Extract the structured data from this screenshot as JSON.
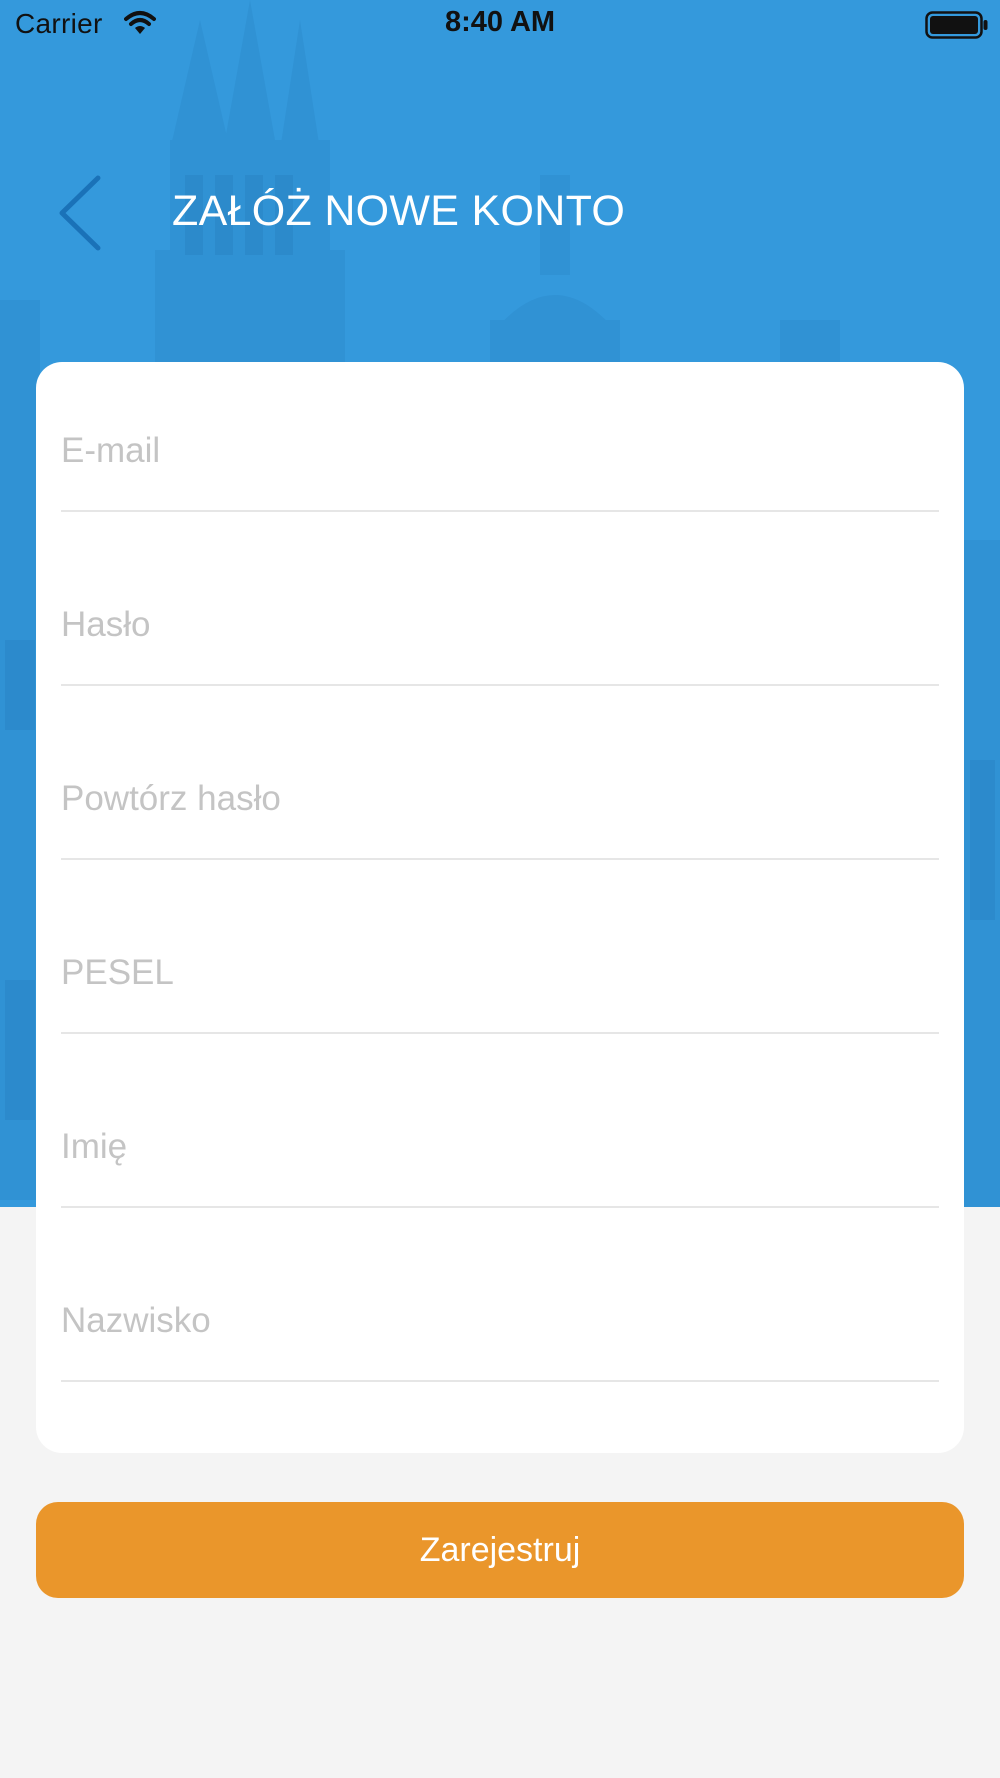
{
  "status_bar": {
    "carrier": "Carrier",
    "time": "8:40 AM",
    "wifi_icon": "wifi-icon",
    "battery_icon": "battery-full-icon"
  },
  "header": {
    "back_icon": "chevron-left-icon",
    "title": "ZAŁÓŻ NOWE KONTO"
  },
  "form": {
    "fields": [
      {
        "name": "email",
        "placeholder": "E-mail",
        "value": ""
      },
      {
        "name": "password",
        "placeholder": "Hasło",
        "value": ""
      },
      {
        "name": "repeat-password",
        "placeholder": "Powtórz hasło",
        "value": ""
      },
      {
        "name": "pesel",
        "placeholder": "PESEL",
        "value": ""
      },
      {
        "name": "first-name",
        "placeholder": "Imię",
        "value": ""
      },
      {
        "name": "last-name",
        "placeholder": "Nazwisko",
        "value": ""
      }
    ]
  },
  "actions": {
    "register_label": "Zarejestruj"
  },
  "colors": {
    "header_background": "#3499dc",
    "accent": "#ea962b",
    "page_background": "#f4f4f4",
    "back_chevron": "#1a72b8"
  }
}
